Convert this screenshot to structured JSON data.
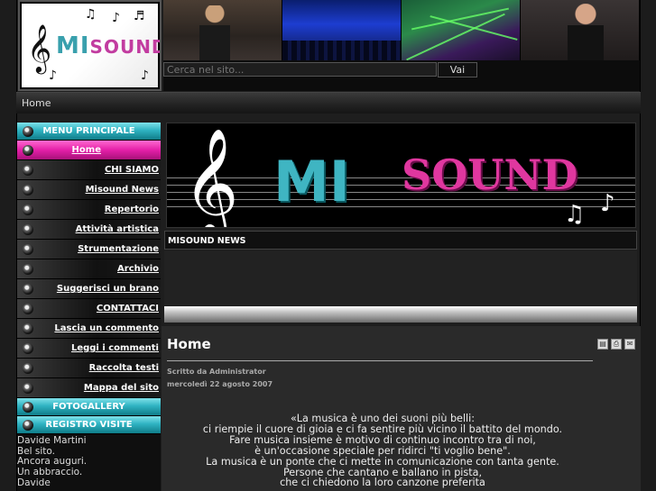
{
  "header": {
    "logo_text_mi": "MI",
    "logo_text_sound": "SOUND",
    "search": {
      "placeholder": "Cerca nel sito...",
      "button_label": "Vai"
    }
  },
  "breadcrumb": "Home",
  "sidebar": {
    "menu_title": "MENU PRINCIPALE",
    "items": [
      {
        "label": "Home",
        "active": true
      },
      {
        "label": "CHI SIAMO"
      },
      {
        "label": "Misound News"
      },
      {
        "label": "Repertorio"
      },
      {
        "label": "Attività artistica"
      },
      {
        "label": "Strumentazione"
      },
      {
        "label": "Archivio"
      },
      {
        "label": "Suggerisci un brano"
      },
      {
        "label": "CONTATTACI"
      },
      {
        "label": "Lascia un commento"
      },
      {
        "label": "Leggi i commenti"
      },
      {
        "label": "Raccolta testi"
      },
      {
        "label": "Mappa del sito"
      }
    ],
    "gallery_title": "FOTOGALLERY",
    "visits_title": "REGISTRO VISITE",
    "visits_lines": [
      "Davide Martini",
      "Bel sito.",
      "Ancora auguri.",
      "Un abbraccio.",
      "Davide"
    ]
  },
  "banner": {
    "mi": "MI",
    "sound": "SOUND"
  },
  "news": {
    "title": "MISOUND NEWS"
  },
  "article": {
    "title": "Home",
    "author": "Scritto da Administrator",
    "date": "mercoledì 22 agosto 2007",
    "poem": [
      "«La musica è uno dei suoni più belli:",
      "ci riempie il cuore di gioia e ci fa sentire più vicino il battito del mondo.",
      "Fare musica insieme è motivo di continuo incontro tra di noi,",
      "è un'occasione speciale per ridirci \"ti voglio bene\".",
      "La musica è un ponte che ci mette in comunicazione con tanta gente.",
      "Persone che cantano e ballano in pista,",
      "che ci chiedono la loro canzone preferita"
    ],
    "tools": [
      "pdf-icon",
      "print-icon",
      "email-icon"
    ]
  },
  "colors": {
    "accent_cyan": "#2fb3c2",
    "accent_magenta": "#e41fa8"
  }
}
